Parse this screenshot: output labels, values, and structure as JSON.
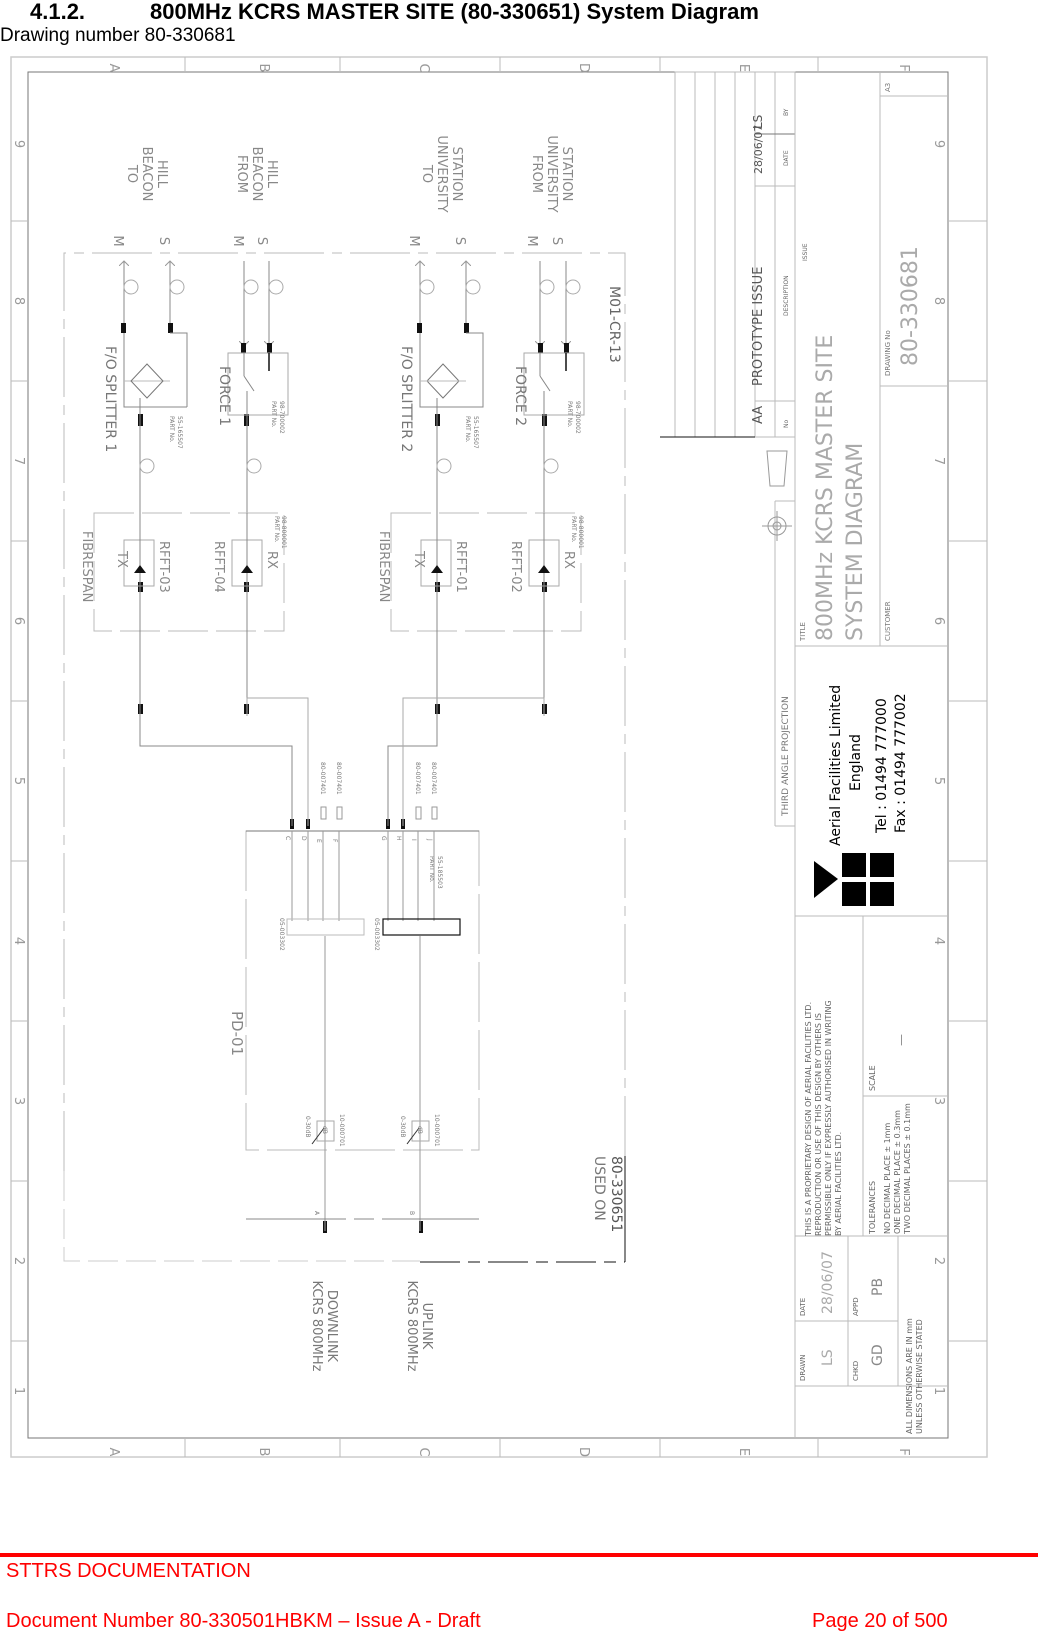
{
  "heading": {
    "section_number": "4.1.2.",
    "title": "800MHz KCRS MASTER SITE (80-330651) System Diagram",
    "drawing_number_line": "Drawing number 80-330681"
  },
  "border": {
    "column_letters": [
      "A",
      "B",
      "C",
      "D",
      "E",
      "F"
    ],
    "row_numbers": [
      "9",
      "8",
      "7",
      "6",
      "5",
      "4",
      "3",
      "2",
      "1"
    ]
  },
  "schematic": {
    "frame_label": "M01-CR-13",
    "used_on_label": "USED ON",
    "used_on_number": "80-330651",
    "destinations": [
      {
        "lines": [
          "TO",
          "BEACON",
          "HILL"
        ],
        "ports": [
          "M",
          "S"
        ]
      },
      {
        "lines": [
          "FROM",
          "BEACON",
          "HILL"
        ],
        "ports": [
          "M",
          "S"
        ]
      },
      {
        "lines": [
          "TO",
          "UNIVERSITY",
          "STATION"
        ],
        "ports": [
          "M",
          "S"
        ]
      },
      {
        "lines": [
          "FROM",
          "UNIVERSITY",
          "STATION"
        ],
        "ports": [
          "M",
          "S"
        ]
      }
    ],
    "splitters": [
      {
        "label": "F/O SPLITTER 1",
        "part_label": "PART No.",
        "part_no": "55-165507"
      },
      {
        "label": "F/O SPLITTER 2",
        "part_label": "PART No.",
        "part_no": "55-165507"
      }
    ],
    "forces": [
      {
        "label": "FORCE 1",
        "part_label": "PART No.",
        "part_no": "98-700002"
      },
      {
        "label": "FORCE 2",
        "part_label": "PART No.",
        "part_no": "98-700002"
      }
    ],
    "fibrespans": [
      {
        "label": "FIBRESPAN",
        "tx_label": "TX",
        "tx_id": "RFFT-03",
        "rx_id": "RFFT-04",
        "rx_label": "RX",
        "part_label": "PART No.",
        "part_no": "98-800001"
      },
      {
        "label": "FIBRESPAN",
        "tx_label": "TX",
        "tx_id": "RFFT-01",
        "rx_id": "RFFT-02",
        "rx_label": "RX",
        "part_label": "PART No.",
        "part_no": "98-800001"
      }
    ],
    "pd": {
      "label": "PD-01",
      "part_label": "PART No.",
      "part_no": "55-185503",
      "ports_top": [
        "C",
        "D",
        "E",
        "F",
        "G",
        "H",
        "I",
        "J"
      ],
      "terminators": [
        "80-007401",
        "80-007401",
        "80-007401",
        "80-007401"
      ],
      "combiners": [
        "05-003302",
        "05-003302"
      ],
      "attenuators": [
        {
          "range": "0-30dB",
          "unit": "dB",
          "part_no": "10-000701"
        },
        {
          "range": "0-30dB",
          "unit": "dB",
          "part_no": "10-000701"
        }
      ],
      "ports_bottom": [
        "A",
        "B"
      ]
    },
    "inputs": [
      {
        "lines": [
          "KCRS 800MHz",
          "DOWNLINK"
        ]
      },
      {
        "lines": [
          "KCRS 800MHz",
          "UPLINK"
        ]
      }
    ]
  },
  "title_block": {
    "revision": {
      "no": "AA",
      "description": "PROTOTYPE ISSUE",
      "date": "28/06/07",
      "by": "LS"
    },
    "revision_headers": {
      "no": "No",
      "description": "DESCRIPTION",
      "date": "DATE",
      "by": "BY",
      "issue": "ISSUE"
    },
    "projection": "THIRD ANGLE PROJECTION",
    "title_label": "TITLE",
    "title_lines": [
      "800MHz KCRS MASTER SITE",
      "SYSTEM DIAGRAM"
    ],
    "customer_label": "CUSTOMER",
    "drawing_no_label": "DRAWING No",
    "drawing_no": "80-330681",
    "sheet_size": "A3",
    "company": {
      "name": "Aerial Facilities Limited",
      "country": "England",
      "tel": "Tel : 01494 777000",
      "fax": "Fax : 01494 777002"
    },
    "proprietary_notice": [
      "THIS IS A PROPRIETARY DESIGN OF AERIAL FACILITIES LTD.",
      "REPRODUCTION OR USE OF THIS DESIGN BY OTHERS IS",
      "PERMISSIBLE ONLY IF EXPRESSLY AUTHORISED IN WRITING",
      "BY AERIAL FACILITIES LTD."
    ],
    "tolerances_label": "TOLERANCES",
    "tolerances": [
      "NO DECIMAL PLACE ± 1mm",
      "ONE DECIMAL PLACE ± 0.3mm",
      "TWO DECIMAL PLACES ± 0.1mm"
    ],
    "scale_label": "SCALE",
    "scale_value": "—",
    "drawn_label": "DRAWN",
    "drawn_value": "LS",
    "date_label": "DATE",
    "date_value": "28/06/07",
    "chkd_label": "CHKD",
    "chkd_value": "GD",
    "appd_label": "APPD",
    "appd_value": "PB",
    "dimensions_note": [
      "ALL DIMENSIONS ARE IN mm",
      "UNLESS OTHERWISE STATED"
    ]
  },
  "footer": {
    "organization": "STTRS DOCUMENTATION",
    "document": "Document Number 80-330501HBKM – Issue A - Draft",
    "page": "Page 20 of 500"
  },
  "colors": {
    "footer_accent": "#ff0000",
    "line_dark": "#555555",
    "line_light": "#bbbbbb"
  }
}
